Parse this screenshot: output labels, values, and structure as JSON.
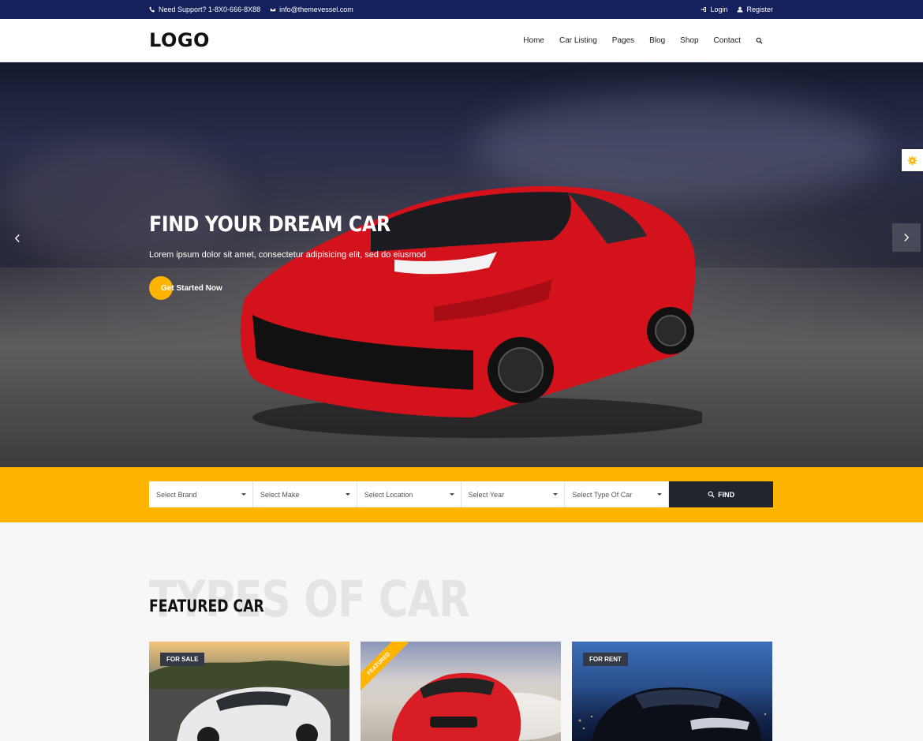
{
  "topbar": {
    "support_text": "Need Support? 1-8X0-666-8X88",
    "email_text": "info@themevessel.com",
    "login_label": "Login",
    "register_label": "Register"
  },
  "header": {
    "logo": "LOGO",
    "nav": [
      "Home",
      "Car Listing",
      "Pages",
      "Blog",
      "Shop",
      "Contact"
    ]
  },
  "hero": {
    "title": "FIND YOUR DREAM CAR",
    "subtitle": "Lorem ipsum dolor sit amet, consectetur adipisicing elit, sed do eiusmod",
    "cta_label": "Get Started Now"
  },
  "search": {
    "selects": [
      "Select Brand",
      "Select Make",
      "Select Location",
      "Select Year",
      "Select Type Of Car"
    ],
    "find_label": "FIND"
  },
  "featured": {
    "bg_title": "TYPES OF CAR",
    "title": "FEATURED CAR",
    "cards": [
      {
        "badge": "FOR SALE"
      },
      {
        "ribbon": "FEATURED"
      },
      {
        "badge": "FOR RENT"
      }
    ]
  },
  "colors": {
    "topbar": "#14215c",
    "accent": "#ffb400",
    "find_button": "#22252e"
  },
  "icons": [
    "phone-icon",
    "envelope-icon",
    "login-icon",
    "user-icon",
    "search-icon",
    "chevron-left-icon",
    "chevron-right-icon",
    "gear-icon"
  ]
}
